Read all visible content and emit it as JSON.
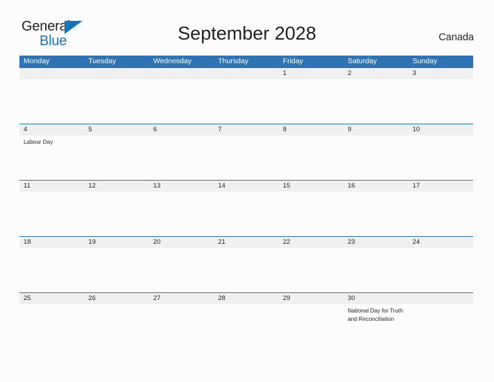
{
  "brand": {
    "name_part1": "General",
    "name_part2": "Blue",
    "triangle_icon": "triangle-icon",
    "color_dark": "#231f20",
    "color_blue": "#1a72b8"
  },
  "header": {
    "title": "September 2028",
    "country": "Canada"
  },
  "calendar": {
    "header_color": "#2e74b5",
    "date_bar_color": "#f0f0f0",
    "weekdays": [
      "Monday",
      "Tuesday",
      "Wednesday",
      "Thursday",
      "Friday",
      "Saturday",
      "Sunday"
    ],
    "weeks": [
      {
        "days": [
          {
            "date": "",
            "event": ""
          },
          {
            "date": "",
            "event": ""
          },
          {
            "date": "",
            "event": ""
          },
          {
            "date": "",
            "event": ""
          },
          {
            "date": "1",
            "event": ""
          },
          {
            "date": "2",
            "event": ""
          },
          {
            "date": "3",
            "event": ""
          }
        ]
      },
      {
        "days": [
          {
            "date": "4",
            "event": "Labour Day"
          },
          {
            "date": "5",
            "event": ""
          },
          {
            "date": "6",
            "event": ""
          },
          {
            "date": "7",
            "event": ""
          },
          {
            "date": "8",
            "event": ""
          },
          {
            "date": "9",
            "event": ""
          },
          {
            "date": "10",
            "event": ""
          }
        ]
      },
      {
        "days": [
          {
            "date": "11",
            "event": ""
          },
          {
            "date": "12",
            "event": ""
          },
          {
            "date": "13",
            "event": ""
          },
          {
            "date": "14",
            "event": ""
          },
          {
            "date": "15",
            "event": ""
          },
          {
            "date": "16",
            "event": ""
          },
          {
            "date": "17",
            "event": ""
          }
        ]
      },
      {
        "days": [
          {
            "date": "18",
            "event": ""
          },
          {
            "date": "19",
            "event": ""
          },
          {
            "date": "20",
            "event": ""
          },
          {
            "date": "21",
            "event": ""
          },
          {
            "date": "22",
            "event": ""
          },
          {
            "date": "23",
            "event": ""
          },
          {
            "date": "24",
            "event": ""
          }
        ]
      },
      {
        "days": [
          {
            "date": "25",
            "event": ""
          },
          {
            "date": "26",
            "event": ""
          },
          {
            "date": "27",
            "event": ""
          },
          {
            "date": "28",
            "event": ""
          },
          {
            "date": "29",
            "event": ""
          },
          {
            "date": "30",
            "event": "National Day for Truth and Reconciliation"
          },
          {
            "date": "",
            "event": ""
          }
        ]
      }
    ]
  }
}
